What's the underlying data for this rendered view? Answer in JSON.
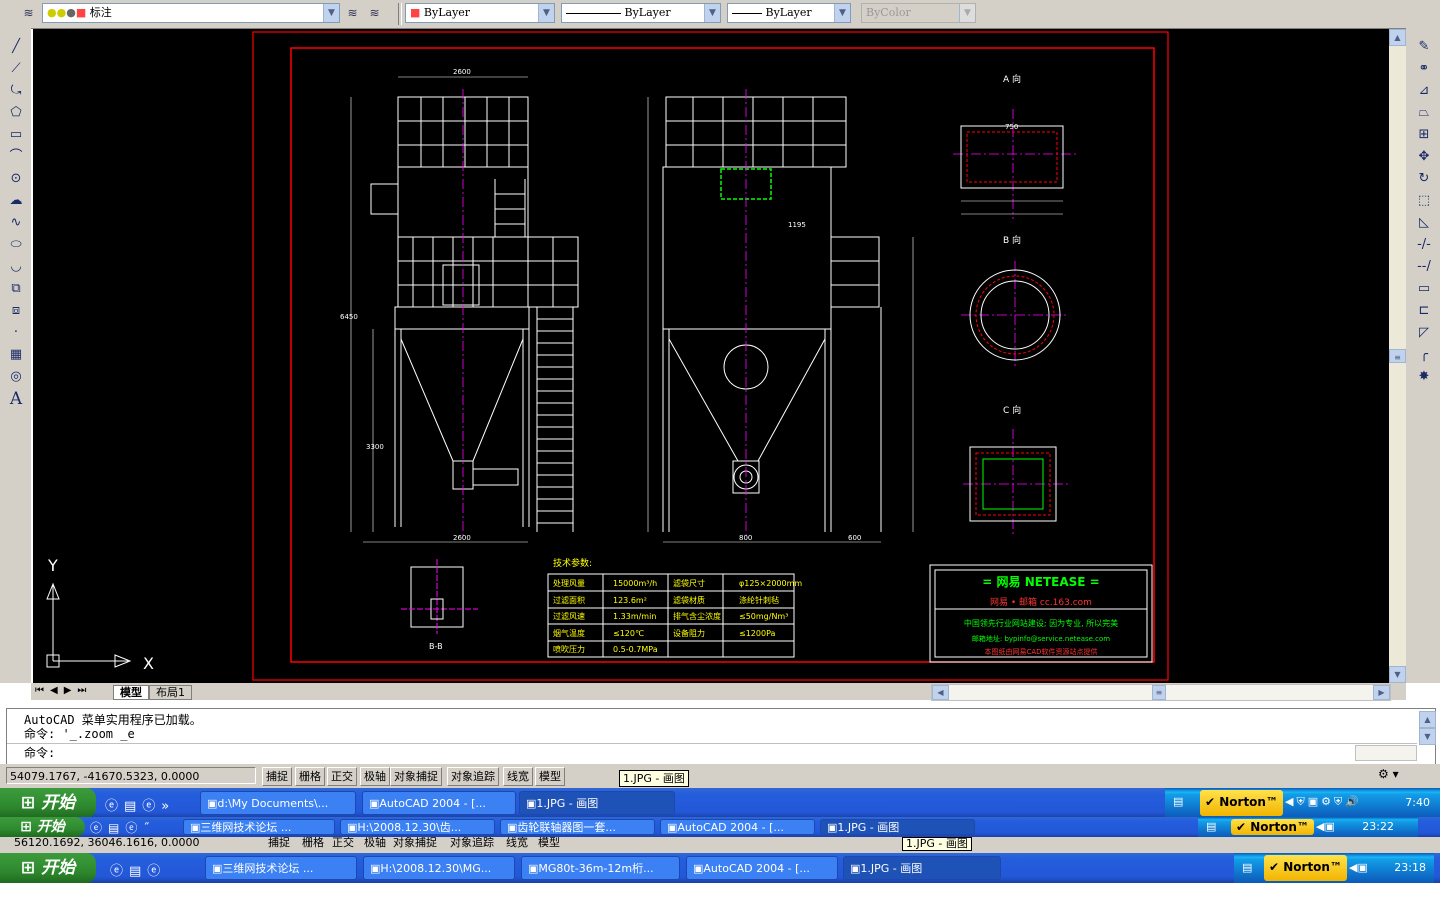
{
  "toolbar": {
    "layer_name": "标注",
    "color": "ByLayer",
    "linetype": "ByLayer",
    "lineweight": "ByLayer",
    "plotstyle": "ByColor"
  },
  "ucs": {
    "x_label": "X",
    "y_label": "Y"
  },
  "drawing": {
    "view_a": "A 向",
    "view_b": "B 向",
    "view_c": "C 向",
    "tech_title": "技术参数:",
    "table": [
      [
        "处理风量",
        "15000m³/h",
        "滤袋尺寸",
        "φ125×2000mm"
      ],
      [
        "过滤面积",
        "123.6m²",
        "滤袋材质",
        "涤纶针刺毡"
      ],
      [
        "过滤风速",
        "1.33m/min",
        "排气含尘浓度",
        "≤50mg/Nm³"
      ],
      [
        "烟气温度",
        "≤120℃",
        "设备阻力",
        "≤1200Pa"
      ],
      [
        "喷吹压力",
        "0.5-0.7MPa",
        "",
        ""
      ]
    ],
    "title_block": {
      "line1": "= 网易 NETEASE =",
      "line2": "网易 • 邮箱  cc.163.com",
      "line3": "中国领先行业网站建设; 因为专业, 所以完美",
      "line4": "邮箱地址: bypinfo@service.netease.com",
      "line5": "本图纸由网易CAD软件资源站点提供"
    },
    "dims": {
      "d1": "2600",
      "d2": "2600",
      "d3": "600",
      "d4": "1195",
      "d5": "6450",
      "d6": "3300",
      "d7": "B-B",
      "d8": "800",
      "d9": "750"
    }
  },
  "tabs": {
    "model": "模型",
    "layout1": "布局1"
  },
  "command": {
    "line1": "AutoCAD 菜单实用程序已加载。",
    "line2": "命令: '_.zoom _e",
    "prompt": "命令:"
  },
  "status": {
    "coords": "54079.1767, -41670.5323, 0.0000",
    "buttons": [
      "捕捉",
      "栅格",
      "正交",
      "极轴",
      "对象捕捉",
      "对象追踪",
      "线宽",
      "模型"
    ],
    "tooltip": "1.JPG - 画图"
  },
  "taskbar1": {
    "start": "开始",
    "tasks": [
      "d:\\My Documents\\...",
      "AutoCAD 2004 - [...",
      "1.JPG - 画图"
    ],
    "tray": {
      "norton": "Norton™",
      "time": "7:40"
    }
  },
  "taskbar2": {
    "start": "开始",
    "tasks": [
      "三维网技术论坛 ...",
      "H:\\2008.12.30\\齿...",
      "齿轮联轴器图一套...",
      "AutoCAD 2004 - [...",
      "1.JPG - 画图"
    ],
    "tray": {
      "norton": "Norton™",
      "time": "23:22"
    }
  },
  "taskbar3": {
    "start": "开始",
    "coords_partial": "56120.1692, 36046.1616, 0.0000",
    "status_partial": [
      "捕捉",
      "栅格",
      "正交",
      "极轴",
      "对象捕捉",
      "对象追踪",
      "线宽",
      "模型"
    ],
    "tooltip": "1.JPG - 画图",
    "tasks": [
      "三维网技术论坛 ...",
      "H:\\2008.12.30\\MG...",
      "MG80t-36m-12m桁...",
      "AutoCAD 2004 - [...",
      "1.JPG - 画图"
    ],
    "tray": {
      "norton": "Norton™",
      "time": "23:18"
    }
  },
  "colors": {
    "canvas": "#000000",
    "frame": "#ff0000",
    "lines": "#ffffff",
    "center": "#ff00ff",
    "accent": "#00ff00"
  }
}
